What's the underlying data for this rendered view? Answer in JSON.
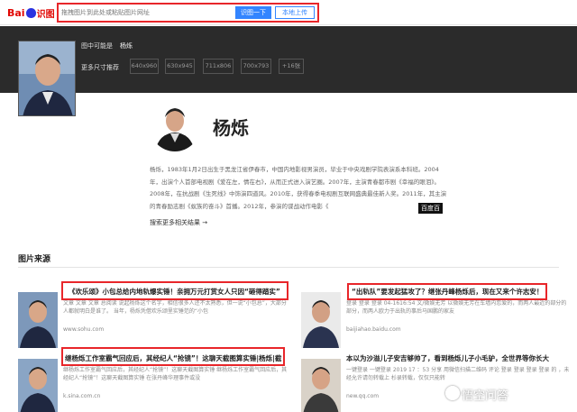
{
  "logo": {
    "bai": "Bai",
    "shitu": "识图"
  },
  "search": {
    "placeholder": "拖拽图片到此处或粘贴图片网址",
    "btn_shitu": "识图一下",
    "btn_upload": "本地上传"
  },
  "header": {
    "maybe_label": "图中可能是",
    "maybe_value": "杨烁",
    "more_sizes": "更多尺寸推荐",
    "sizes": [
      "640x960",
      "630x945",
      "711x806",
      "700x793",
      "+16张"
    ]
  },
  "person": {
    "name": "杨烁",
    "bio": "杨烁，1983年1月2日出生于黑龙江省伊春市，中国内地影视男演员，毕业于中央戏剧学院表演系本科班。2004年，出演个人首部电视剧《爱在左，情在右》，从而正式进入演艺圈。2007年，主演青春都市剧《幸福的眼泪》。2008年，在抗战剧《生死线》中饰演四道风。2010年，获得春季电视剧互联网盛典最佳新人奖。2011年，其主演的青春励志剧《蚁族的奋斗》首播。2012年，参演的谍战动作电影《",
    "bio_more": "百度百",
    "search_more": "搜索更多相关结果 →"
  },
  "section": {
    "title": "图片来源"
  },
  "results": [
    {
      "title": "《欢乐颂》小包总给内地轨爆实锤！亲拥万元打赏女人只因“砸得踏实”",
      "desc": "文章 文章 文章 总阅读 说起杨烁这个名字，相信很多人还不太熟悉，但一说“小包总”，大部分人都就明白是谁了。 当年，杨烁凭借欢乐颂里实锤范的“小包",
      "url": "www.sohu.com"
    },
    {
      "title": "“出轨队”要发起猛攻了？继张丹峰杨烁后，现在又来个许志安！",
      "desc": "登录 登录 登录 04-1616:54 文/微娱无芳 以微娱无芳在车墙内恋爱的，而两人最近的部分的部分，而两人欧力于出轨的事后马国鹏的家友",
      "url": "baijiahao.baidu.com"
    },
    {
      "title": "继杨烁工作室霸气回应后，其经纪人“抢镜”！这聊天截图算实锤|杨烁|截",
      "desc": "继杨烁工作室霸气回应后，其经纪人“抢镜”！这聊天截图算实锤 继杨烁工作室霸气回应后，其经纪人“抢镜”！这聊天截图算实锤 在张丹峰华理事件或没",
      "url": "k.sina.com.cn"
    },
    {
      "title": "本以为沙溢儿子安吉够帅了，看到杨烁儿子小毛驴，全世界等你长大",
      "desc": "一键登录 一键登录 2019 17 ：53 分享 用微信扫描二维码 评论 登录 登录 登录 登录 的 ，未经允许请勿转载上 杉录转载，仅仅只能转",
      "url": "new.qq.com"
    }
  ],
  "watermark": "悟空问答"
}
